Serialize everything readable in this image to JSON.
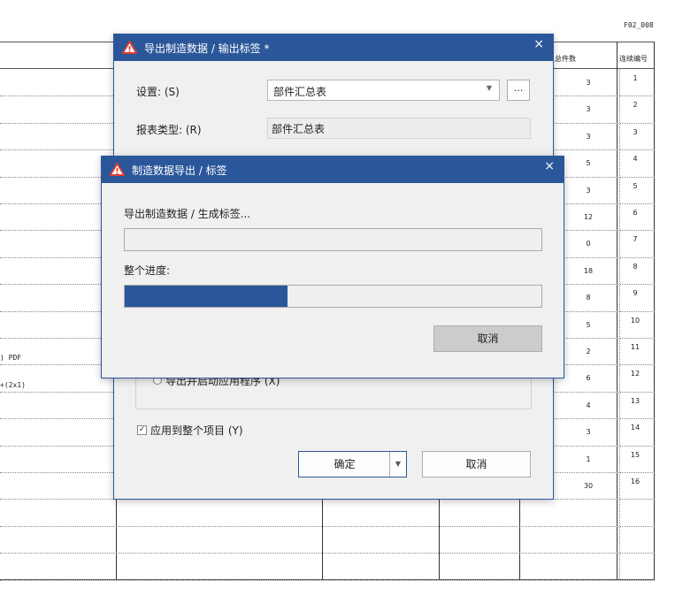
{
  "sheet": {
    "code": "F02_008",
    "col_total": "总件数",
    "col_seq": "连续编号",
    "totals": [
      "3",
      "3",
      "3",
      "5",
      "3",
      "12",
      "0",
      "18",
      "8",
      "5",
      "2",
      "6",
      "4",
      "3",
      "1",
      "30"
    ],
    "seqs": [
      "1",
      "2",
      "3",
      "4",
      "5",
      "6",
      "7",
      "8",
      "9",
      "10",
      "11",
      "12",
      "13",
      "14",
      "15",
      "16"
    ],
    "left_texts": [
      ") PDF",
      "+(2x1)"
    ]
  },
  "main_dialog": {
    "title": "导出制造数据 / 输出标签 *",
    "close_glyph": "×",
    "settings_label": "设置: (S)",
    "settings_value": "部件汇总表",
    "more_button": "...",
    "report_type_label": "报表类型: (R)",
    "report_type_value": "部件汇总表",
    "radio_export_launch": "导出并启动应用程序 (X)",
    "apply_all_label": "应用到整个项目 (Y)",
    "apply_all_checked": "✓",
    "ok_button": "确定",
    "cancel_button": "取消"
  },
  "progress_dialog": {
    "title": "制造数据导出 / 标签",
    "close_glyph": "×",
    "task_label": "导出制造数据 / 生成标签...",
    "task_progress": 0,
    "overall_label": "整个进度:",
    "overall_progress": 0.39,
    "cancel_button": "取消"
  },
  "colors": {
    "accent": "#2b579a",
    "warning_icon": "#e23b2e"
  },
  "icons": {
    "title_icon": "warning-triangle-icon"
  }
}
